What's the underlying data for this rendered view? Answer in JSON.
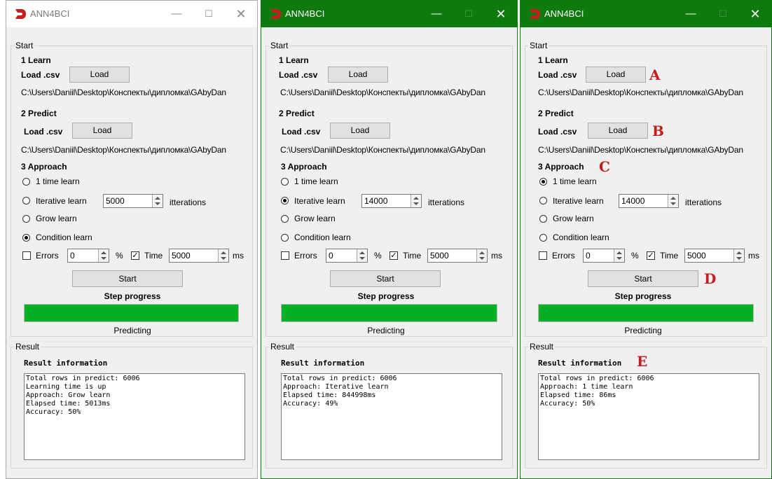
{
  "windows": [
    {
      "state": "inactive",
      "title": "ANN4BCI",
      "start_group": "Start",
      "learn_heading": "1 Learn",
      "load_label_1": "Load .csv",
      "load_button_1": "Load",
      "path_1": "C:\\Users\\Daniil\\Desktop\\Конспекты\\дипломка\\GAbyDan",
      "predict_heading": "2 Predict",
      "load_label_2": "Load .csv",
      "load_button_2": "Load",
      "path_2": "C:\\Users\\Daniil\\Desktop\\Конспекты\\дипломка\\GAbyDan",
      "approach_heading": "3 Approach",
      "radios": [
        "1 time learn",
        "Iterative learn",
        "Grow learn",
        "Condition learn"
      ],
      "selected_radio": 3,
      "iterations_value": "5000",
      "iterations_label": "itterations",
      "errors_label": "Errors",
      "errors_value": "0",
      "percent_label": "%",
      "time_label": "Time",
      "time_value": "5000",
      "ms_label": "ms",
      "start_button": "Start",
      "step_progress_label": "Step progress",
      "progress": 1.0,
      "status": "Predicting",
      "result_group": "Result",
      "result_info_label": "Result information",
      "result_text": "Total rows in predict: 6006\nLearning time is up\nApproach: Grow learn\nElapsed time: 5013ms\nAccuracy: 50%"
    },
    {
      "state": "active",
      "title": "ANN4BCI",
      "start_group": "Start",
      "learn_heading": "1 Learn",
      "load_label_1": "Load .csv",
      "load_button_1": "Load",
      "path_1": "C:\\Users\\Daniil\\Desktop\\Конспекты\\дипломка\\GAbyDan",
      "predict_heading": "2 Predict",
      "load_label_2": "Load .csv",
      "load_button_2": "Load",
      "path_2": "C:\\Users\\Daniil\\Desktop\\Конспекты\\дипломка\\GAbyDan",
      "approach_heading": "3 Approach",
      "radios": [
        "1 time learn",
        "Iterative learn",
        "Grow learn",
        "Condition learn"
      ],
      "selected_radio": 1,
      "iterations_value": "14000",
      "iterations_label": "itterations",
      "errors_label": "Errors",
      "errors_value": "0",
      "percent_label": "%",
      "time_label": "Time",
      "time_value": "5000",
      "ms_label": "ms",
      "start_button": "Start",
      "step_progress_label": "Step progress",
      "progress": 1.0,
      "status": "Predicting",
      "result_group": "Result",
      "result_info_label": "Result information",
      "result_text": "Total rows in predict: 6006\nApproach: Iterative learn\nElapsed time: 844998ms\nAccuracy: 49%"
    },
    {
      "state": "active",
      "title": "ANN4BCI",
      "start_group": "Start",
      "learn_heading": "1 Learn",
      "load_label_1": "Load .csv",
      "load_button_1": "Load",
      "path_1": "C:\\Users\\Daniil\\Desktop\\Конспекты\\дипломка\\GAbyDan",
      "predict_heading": "2 Predict",
      "load_label_2": "Load .csv",
      "load_button_2": "Load",
      "path_2": "C:\\Users\\Daniil\\Desktop\\Конспекты\\дипломка\\GAbyDan",
      "approach_heading": "3 Approach",
      "radios": [
        "1 time learn",
        "Iterative learn",
        "Grow learn",
        "Condition learn"
      ],
      "selected_radio": 0,
      "iterations_value": "14000",
      "iterations_label": "itterations",
      "errors_label": "Errors",
      "errors_value": "0",
      "percent_label": "%",
      "time_label": "Time",
      "time_value": "5000",
      "ms_label": "ms",
      "start_button": "Start",
      "step_progress_label": "Step progress",
      "progress": 1.0,
      "status": "Predicting",
      "result_group": "Result",
      "result_info_label": "Result information",
      "result_text": "Total rows in predict: 6006\nApproach: 1 time learn\nElapsed time: 86ms\nAccuracy: 50%",
      "markers": {
        "a": "A",
        "b": "B",
        "c": "C",
        "d": "D",
        "e": "E"
      }
    }
  ],
  "titlebar_buttons": {
    "minimize": "—",
    "maximize": "☐",
    "close": "✕"
  },
  "colors": {
    "active_titlebar": "#0e7a0e",
    "progress_fill": "#06b025",
    "marker": "#c41e1e",
    "logo": "#c41e1e"
  }
}
